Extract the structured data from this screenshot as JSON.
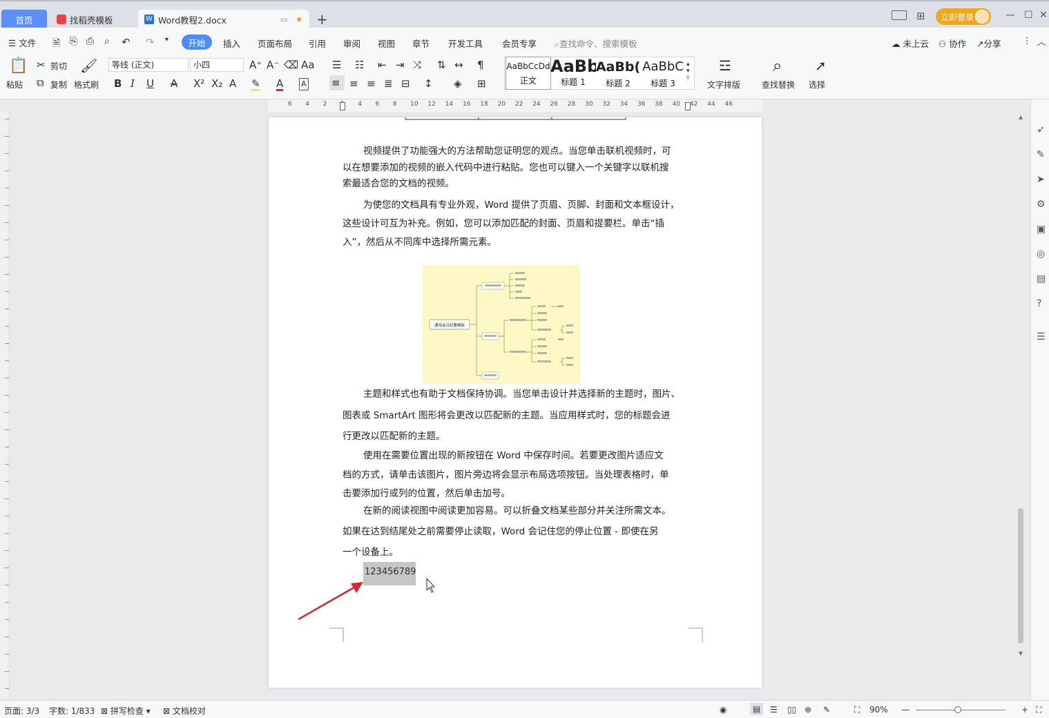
{
  "titlebar": {
    "tabs": [
      {
        "label": "首页"
      },
      {
        "label": "找稻壳模板"
      },
      {
        "label": "Word教程2.docx"
      }
    ],
    "login_label": "立即登录"
  },
  "menubar": {
    "file_label": "文件",
    "active_tab": "开始",
    "items": [
      "插入",
      "页面布局",
      "引用",
      "审阅",
      "视图",
      "章节",
      "开发工具",
      "会员专享"
    ],
    "search_placeholder": "查找命令、搜索模板",
    "cloud_label": "未上云",
    "collab_label": "协作",
    "share_label": "分享"
  },
  "toolbar": {
    "paste": "粘贴",
    "cut": "剪切",
    "copy": "复制",
    "format_painter": "格式刷",
    "font_name": "等线 (正文)",
    "font_size": "小四",
    "styles": [
      {
        "preview": "AaBbCcDd",
        "name": "正文"
      },
      {
        "preview": "AaBb",
        "name": "标题 1"
      },
      {
        "preview": "AaBb(",
        "name": "标题 2"
      },
      {
        "preview": "AaBbC",
        "name": "标题 3"
      }
    ],
    "text_layout": "文字排版",
    "find_replace": "查找替换",
    "select": "选择"
  },
  "ruler": {
    "ticks": [
      "6",
      "4",
      "2",
      "2",
      "4",
      "6",
      "8",
      "10",
      "12",
      "14",
      "16",
      "18",
      "20",
      "22",
      "24",
      "26",
      "28",
      "30",
      "32",
      "34",
      "36",
      "38",
      "40",
      "42",
      "44",
      "46"
    ]
  },
  "document": {
    "paragraphs": [
      [
        "视频提供了功能强大的方法帮助您证明您的观点。当您单击联机视频时，可",
        "以在想要添加的视频的嵌入代码中进行粘贴。您也可以键入一个关键字以联机搜",
        "索最适合您的文档的视频。"
      ],
      [
        "为使您的文档具有专业外观，Word 提供了页眉、页脚、封面和文本框设计，",
        "这些设计可互为补充。例如，您可以添加匹配的封面、页眉和提要栏。单击“插",
        "入”，然后从不同库中选择所需元素。"
      ],
      [
        "主题和样式也有助于文档保持协调。当您单击设计并选择新的主题时，图片、",
        "图表或 SmartArt 图形将会更改以匹配新的主题。当应用样式时，您的标题会进",
        "行更改以匹配新的主题。"
      ],
      [
        "使用在需要位置出现的新按钮在 Word 中保存时间。若要更改图片适应文",
        "档的方式，请单击该图片，图片旁边将会显示布局选项按钮。当处理表格时，单",
        "击要添加行或列的位置，然后单击加号。"
      ],
      [
        "在新的阅读视图中阅读更加容易。可以折叠文档某些部分并关注所需文本。",
        "如果在达到结尾处之前需要停止读取，Word 会记住您的停止位置 - 即使在另",
        "一个设备上。"
      ]
    ],
    "selected_text": "123456789",
    "mindmap_root": "通用会议纪要模板"
  },
  "status": {
    "page": "页面: 3/3",
    "words": "字数: 1/833",
    "spell": "拼写检查",
    "proof": "文档校对",
    "zoom": "90%"
  },
  "colors": {
    "accent": "#4d8cf5",
    "login": "#f0a71a",
    "arrow": "#d9262c"
  }
}
